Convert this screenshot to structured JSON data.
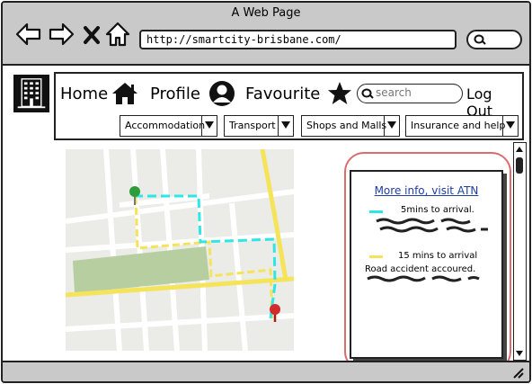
{
  "window": {
    "title": "A Web Page"
  },
  "browser": {
    "url": "http://smartcity-brisbane.com/",
    "back_icon": "back-arrow-icon",
    "forward_icon": "forward-arrow-icon",
    "stop_icon": "close-icon",
    "home_icon": "home-icon",
    "search_icon": "search-icon"
  },
  "logo": {
    "icon": "building-icon"
  },
  "nav": {
    "home": "Home",
    "profile": "Profile",
    "favourite": "Favourite",
    "search_placeholder": "search",
    "logout": "Log Out"
  },
  "dropdowns": [
    {
      "label": "Accommodation"
    },
    {
      "label": "Transport"
    },
    {
      "label": "Shops and Malls"
    },
    {
      "label": "Insurance and help"
    }
  ],
  "map": {
    "route_fast_color": "#2fe6e6",
    "route_slow_color": "#f5e35a",
    "start_pin_color": "#2e9e3a",
    "end_pin_color": "#d12b2b"
  },
  "info_panel": {
    "link": "More info, visit ATN",
    "legend": [
      {
        "color": "#2fe6e6",
        "text": "5mins to arrival."
      },
      {
        "color": "#f5e35a",
        "text": "15 mins to arrival"
      }
    ],
    "note": "Road accident accoured.",
    "outline_color": "#d96c6c"
  }
}
